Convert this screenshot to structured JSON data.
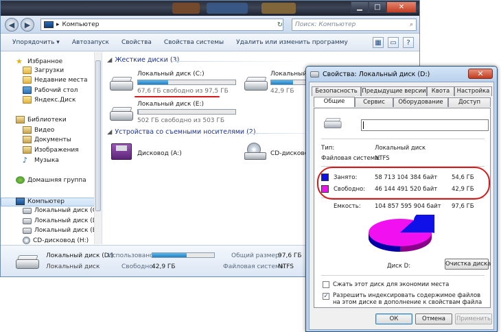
{
  "explorer": {
    "address": "Компьютер",
    "search_placeholder": "Поиск: Компьютер",
    "toolbar": {
      "organize": "Упорядочить ▾",
      "autoplay": "Автозапуск",
      "properties": "Свойства",
      "system_properties": "Свойства системы",
      "uninstall": "Удалить или изменить программу"
    },
    "nav": {
      "favorites": "Избранное",
      "downloads": "Загрузки",
      "recent": "Недавние места",
      "desktop": "Рабочий стол",
      "yandex": "Яндекс.Диск",
      "libraries": "Библиотеки",
      "video": "Видео",
      "documents": "Документы",
      "pictures": "Изображения",
      "music": "Музыка",
      "homegroup": "Домашняя группа",
      "computer": "Компьютер",
      "drive_c": "Локальный диск (C:)",
      "drive_d": "Локальный диск (D:)",
      "drive_e": "Локальный диск (E:)",
      "drive_h": "CD-дисковод (H:)"
    },
    "groups": {
      "hard_disks": "Жесткие диски (3)",
      "removable": "Устройства со съемными носителями (2)"
    },
    "drives": {
      "c": {
        "name": "Локальный диск (C:)",
        "free": "67,6 ГБ свободно из 97,5 ГБ",
        "used_fraction": 0.31
      },
      "d": {
        "name": "Локальный",
        "free": "42,9 ГБ",
        "used_fraction": 0.56
      },
      "e": {
        "name": "Локальный диск (E:)",
        "free": "502 ГБ свободно из 503 ГБ",
        "used_fraction": 0.01
      },
      "floppy": {
        "name": "Дисковод (A:)"
      },
      "cd": {
        "name": "CD-дисковод"
      }
    },
    "details": {
      "name": "Локальный диск (D:)",
      "type": "Локальный диск",
      "used_label": "Использовано:",
      "used_fraction": 0.56,
      "free_label": "Свободно:",
      "free_value": "42,9 ГБ",
      "total_label": "Общий размер:",
      "total_value": "97,6 ГБ",
      "fs_label": "Файловая система:",
      "fs_value": "NTFS"
    }
  },
  "dialog": {
    "title": "Свойства: Локальный диск (D:)",
    "close": "✕",
    "tabs_row1": [
      "Безопасность",
      "Предыдущие версии",
      "Квота",
      "Настройка"
    ],
    "tabs_row2": [
      "Общие",
      "Сервис",
      "Оборудование",
      "Доступ"
    ],
    "type_label": "Тип:",
    "type_value": "Локальный диск",
    "fs_label": "Файловая система:",
    "fs_value": "NTFS",
    "used_label": "Занято:",
    "used_bytes": "58 713 104 384 байт",
    "used_gb": "54,6 ГБ",
    "used_color": "#1010e8",
    "free_label": "Свободно:",
    "free_bytes": "46 144 491 520 байт",
    "free_gb": "42,9 ГБ",
    "free_color": "#f010f0",
    "capacity_label": "Емкость:",
    "capacity_bytes": "104 857 595 904 байт",
    "capacity_gb": "97,6 ГБ",
    "disk_label": "Диск D:",
    "cleanup_button": "Очистка диска",
    "compress_label": "Сжать этот диск для экономии места",
    "index_label": "Разрешить индексировать содержимое файлов на этом диске в дополнение к свойствам файла",
    "compress_checked": false,
    "index_checked": true,
    "ok": "ОК",
    "cancel": "Отмена",
    "apply": "Применить"
  }
}
